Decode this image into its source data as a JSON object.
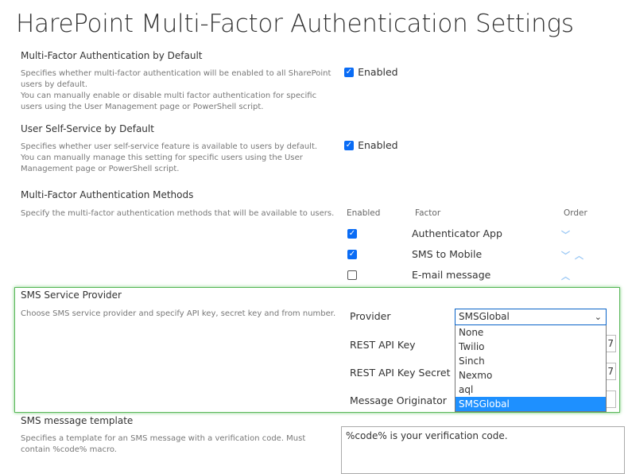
{
  "title": "HarePoint Multi-Factor Authentication Settings",
  "mfa_default": {
    "title": "Multi-Factor Authentication by Default",
    "desc1": "Specifies whether multi-factor authentication will be enabled to all SharePoint users by default.",
    "desc2": "You can manually enable or disable multi factor authentication for specific users using the User Management page or PowerShell script.",
    "checkbox_label": "Enabled",
    "checked": true
  },
  "self_service": {
    "title": "User Self-Service by Default",
    "desc1": "Specifies whether user self-service feature is available to users by default.",
    "desc2": "You can manually manage this setting for specific users using the User Management page or PowerShell script.",
    "checkbox_label": "Enabled",
    "checked": true
  },
  "methods": {
    "title": "Multi-Factor Authentication Methods",
    "desc": "Specify the multi-factor authentication methods that will be available to users.",
    "headers": {
      "enabled": "Enabled",
      "factor": "Factor",
      "order": "Order"
    },
    "rows": [
      {
        "factor": "Authenticator App",
        "enabled": true,
        "order": [
          "down"
        ]
      },
      {
        "factor": "SMS to Mobile",
        "enabled": true,
        "order": [
          "down",
          "up"
        ]
      },
      {
        "factor": "E-mail message",
        "enabled": false,
        "order": [
          "up"
        ]
      }
    ]
  },
  "sms": {
    "title": "SMS Service Provider",
    "desc": "Choose SMS service provider and specify API key, secret key and from number.",
    "provider_label": "Provider",
    "provider_value": "SMSGlobal",
    "options": [
      "None",
      "Twilio",
      "Sinch",
      "Nexmo",
      "aql",
      "SMSGlobal"
    ],
    "api_key_label": "REST API Key",
    "api_key_visible": "7",
    "api_secret_label": "REST API Key Secret",
    "api_secret_visible": "7",
    "originator_label": "Message Originator",
    "originator_value": ""
  },
  "template": {
    "title": "SMS message template",
    "desc": "Specifies a template for an SMS message with a verification code. Must contain %code% macro.",
    "value": "%code% is your verification code."
  },
  "colors": {
    "accent": "#0a6cf5",
    "highlight_border": "#5cb85c",
    "selected_option": "#1e90ff"
  }
}
